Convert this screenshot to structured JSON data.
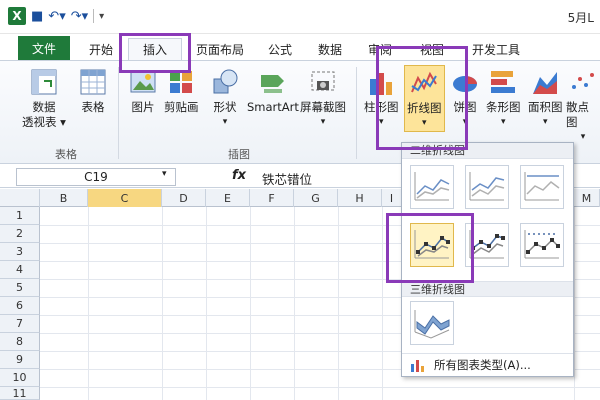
{
  "titlebar": {
    "logo": "X",
    "title": "5月L"
  },
  "tabs": [
    "文件",
    "开始",
    "插入",
    "页面布局",
    "公式",
    "数据",
    "审阅",
    "视图",
    "开发工具"
  ],
  "ribbon": {
    "pivot_label": [
      "数据",
      "透视表 ▾"
    ],
    "table_label": "表格",
    "picture_label": "图片",
    "clipart_label": "剪贴画",
    "shapes_label": [
      "形状",
      "▾"
    ],
    "smartart_label": "SmartArt",
    "screenshot_label": [
      "屏幕截图",
      "▾"
    ],
    "column_label": [
      "柱形图",
      "▾"
    ],
    "line_label": [
      "折线图",
      "▾"
    ],
    "pie_label": [
      "饼图",
      "▾"
    ],
    "bar_label": [
      "条形图",
      "▾"
    ],
    "area_label": [
      "面积图",
      "▾"
    ],
    "scatter_label": [
      "散点图",
      "▾"
    ],
    "group_tables": "表格",
    "group_illustrations": "插图"
  },
  "formula_bar": {
    "name_box": "C19",
    "fx": "fx",
    "value": "铁芯错位"
  },
  "columns": [
    "B",
    "C",
    "D",
    "E",
    "F",
    "G",
    "H",
    "I",
    "M"
  ],
  "rows": [
    "1",
    "2",
    "3",
    "4",
    "5",
    "6",
    "7",
    "8",
    "9",
    "10",
    "11"
  ],
  "dropdown": {
    "header_2d": "二维折线图",
    "header_3d": "三维折线图",
    "footer": "所有图表类型(A)..."
  },
  "colors": {
    "excel_green": "#1f7a3a",
    "annotation_purple": "#8a3ab8",
    "highlight_yellow": "#fff3c4"
  }
}
